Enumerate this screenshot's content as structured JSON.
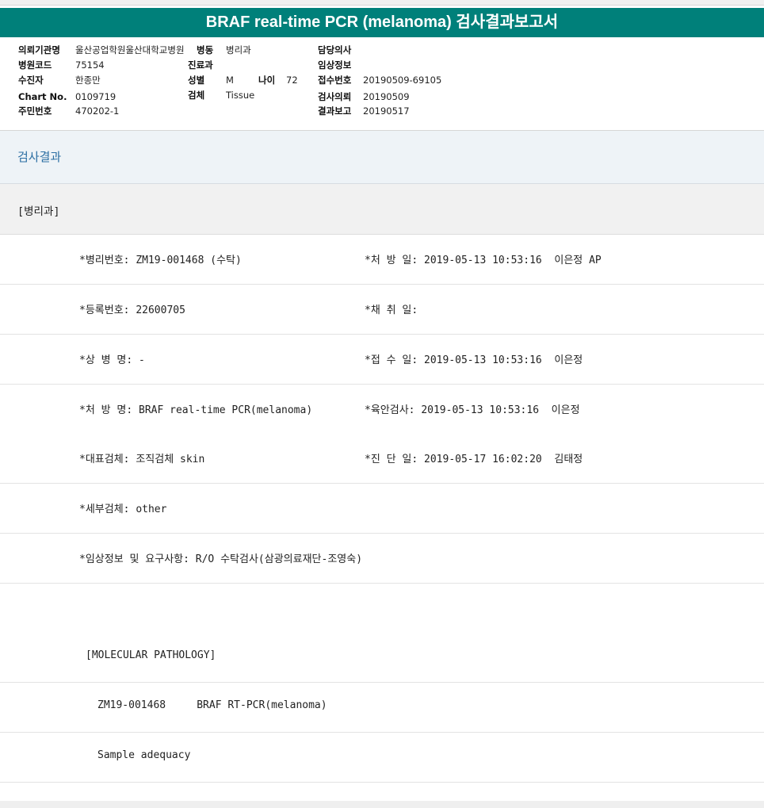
{
  "report": {
    "title": "BRAF real-time PCR (melanoma) 검사결과보고서"
  },
  "info": {
    "institution_label": "의뢰기관명",
    "institution_value": "울산공업학원울산대학교병원",
    "ward_label": "병동",
    "ward_value": "병리과",
    "doctor_label": "담당의사",
    "doctor_value": "",
    "hospital_code_label": "병원코드",
    "hospital_code_value": "75154",
    "department_label": "진료과",
    "department_value": "",
    "clinical_info_label": "임상정보",
    "clinical_info_value": "",
    "patient_label": "수진자",
    "patient_value": "한종만",
    "sex_label": "성별",
    "sex_value": "M",
    "age_label": "나이",
    "age_value": "72",
    "receipt_no_label": "접수번호",
    "receipt_no_value": "20190509-69105",
    "chart_label": "Chart No.",
    "chart_value": "0109719",
    "specimen_label": "검체",
    "specimen_value": "Tissue",
    "request_label": "검사의뢰",
    "request_value": "20190509",
    "id_label": "주민번호",
    "id_value": "470202-1",
    "result_report_label": "결과보고",
    "result_report_value": "20190517"
  },
  "section": {
    "title": "검사결과",
    "department": "[병리과]"
  },
  "rows": {
    "pathology_no": "*병리번호: ZM19-001468 (수탁)",
    "prescription_date": "*처 방 일: 2019-05-13 10:53:16  이은정 AP",
    "registration_no": "*등록번호: 22600705",
    "collection_date": "*채 취 일:",
    "disease_name": "*상 병 명: -",
    "received_date": "*접 수 일: 2019-05-13 10:53:16  이은정",
    "prescription_name": "*처 방 명: BRAF real-time PCR(melanoma)",
    "gross_exam": "*육안검사: 2019-05-13 10:53:16  이은정",
    "main_specimen": "*대표검체: 조직검체 skin",
    "diagnosis_date": "*진 단 일: 2019-05-17 16:02:20  김태정",
    "sub_specimen": "*세부검체: other",
    "clinical_request": "*임상정보 및 요구사항: R/O 수탁검사(삼광의료재단-조영숙)",
    "molecular_header": "[MOLECULAR PATHOLOGY]",
    "case_line": "ZM19-001468     BRAF RT-PCR(melanoma)",
    "sample_adequacy": "Sample adequacy"
  }
}
